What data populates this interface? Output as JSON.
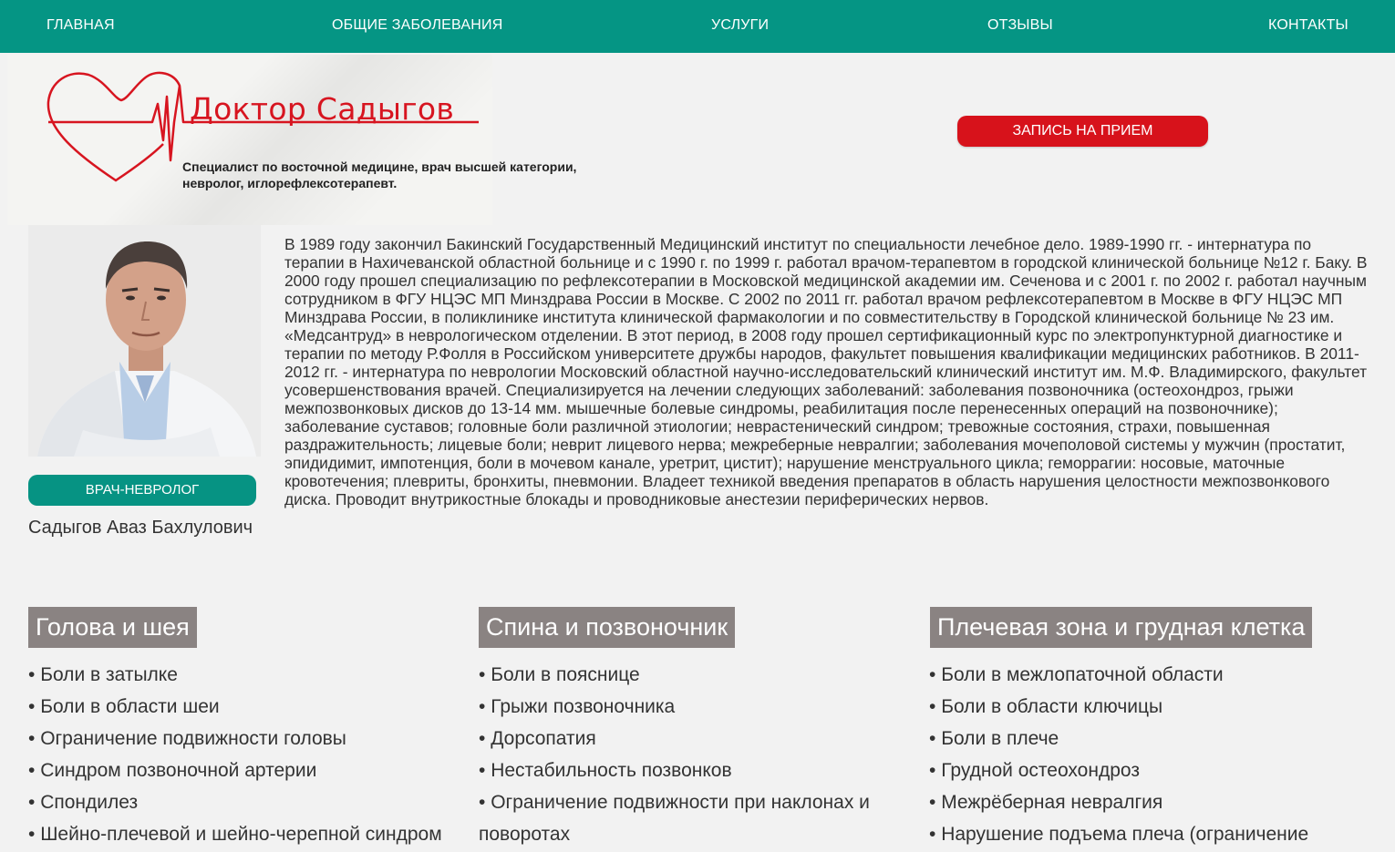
{
  "nav": {
    "items": [
      "ГЛАВНАЯ",
      "ОБЩИЕ ЗАБОЛЕВАНИЯ",
      "УСЛУГИ",
      "ОТЗЫВЫ",
      "КОНТАКТЫ"
    ]
  },
  "brand": {
    "title": "Доктор Садыгов",
    "subtitle_line1": "Специалист по восточной медицине, врач высшей категории,",
    "subtitle_line2": "невролог, иглорефлексотерапевт."
  },
  "cta": {
    "label": "ЗАПИСЬ НА ПРИЕМ"
  },
  "doctor": {
    "role": "ВРАЧ-НЕВРОЛОГ",
    "name": "Садыгов Аваз Бахлулович",
    "bio": "В 1989 году закончил Бакинский Государственный Медицинский институт по специальности лечебное дело. 1989-1990 гг. - интернатура по терапии в Нахичеванской областной больнице и с 1990 г. по 1999 г. работал врачом-терапевтом в городской клинической больнице №12 г. Баку. В 2000 году прошел специализацию по рефлексотерапии в Московской медицинской академии им. Сеченова и с 2001 г. по 2002 г. работал научным сотрудником в ФГУ НЦЭС МП Минздрава России в Москве. С 2002 по 2011 гг. работал врачом рефлексотерапевтом в Москве в ФГУ НЦЭС МП Минздрава России, в поликлинике института клинической фармакологии и по совместительству в Городской клинической больнице № 23 им. «Медсантруд» в неврологическом отделении. В этот период, в 2008 году прошел сертификационный курс по электропунктурной диагностике и терапии по методу Р.Фолля в Российском университете дружбы народов, факультет повышения квалификации медицинских работников. В 2011-2012 гг. - интернатура по неврологии Московский областной научно-исследовательский клинический институт им. М.Ф. Владимирского, факультет усовершенствования врачей. Специализируется на лечении следующих заболеваний: заболевания позвоночника (остеохондроз, грыжи межпозвонковых дисков до 13-14 мм. мышечные болевые синдромы, реабилитация после перенесенных операций на позвоночнике); заболевание суставов; головные боли различной этиологии; неврастенический синдром; тревожные состояния, страхи, повышенная раздражительность; лицевые боли; неврит лицевого нерва; межреберные невралгии; заболевания мочеполовой системы у мужчин (простатит, эпидидимит, импотенция, боли в мочевом канале, уретрит, цистит); нарушение менструального цикла; геморрагии: носовые, маточные кровотечения; плевриты, бронхиты, пневмонии. Владеет техникой введения препаратов в область нарушения целостности межпозвонкового диска. Проводит внутрикостные блокады и проводниковые анестезии периферических нервов."
  },
  "categories": [
    {
      "title": "Голова и шея",
      "items": [
        "Боли в затылке",
        "Боли в области шеи",
        "Ограничение подвижности головы",
        "Синдром позвоночной артерии",
        "Спондилез",
        "Шейно-плечевой и шейно-черепной синдром"
      ]
    },
    {
      "title": "Спина и позвоночник",
      "items": [
        "Боли в пояснице",
        "Грыжи позвоночника",
        "Дорсопатия",
        "Нестабильность позвонков",
        "Ограничение подвижности при наклонах и поворотах"
      ]
    },
    {
      "title": "Плечевая зона и грудная клетка",
      "items": [
        "Боли в межлопаточной области",
        "Боли в области ключицы",
        "Боли в плече",
        "Грудной остеохондроз",
        "Межрёберная невралгия",
        "Нарушение подъема плеча (ограничение"
      ]
    }
  ],
  "colors": {
    "nav_bg": "#059584",
    "brand_red": "#d71520",
    "badge_teal": "#069383",
    "category_bg": "#8a8382"
  }
}
